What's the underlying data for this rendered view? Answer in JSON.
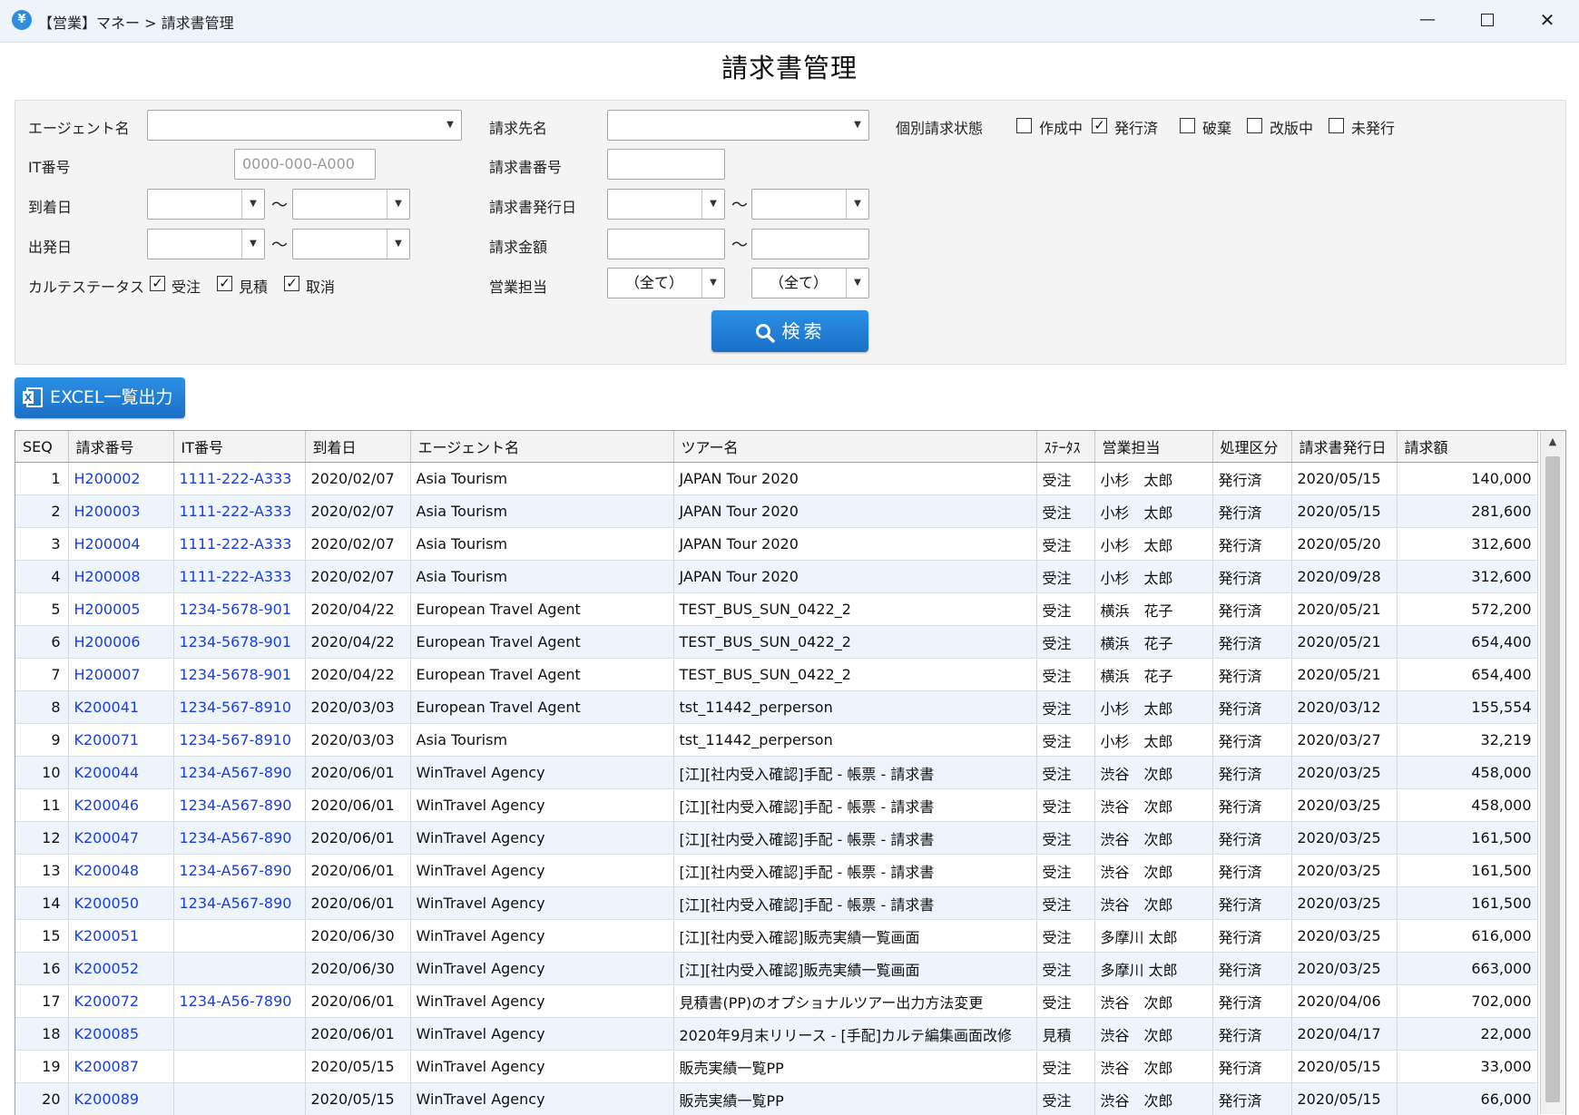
{
  "window": {
    "title": "【営業】マネー > 請求書管理",
    "minimize": "—",
    "close": "✕"
  },
  "page_title": "請求書管理",
  "filters": {
    "agent_name_label": "エージェント名",
    "billing_to_label": "請求先名",
    "individual_status_label": "個別請求状態",
    "status_options": [
      {
        "label": "作成中",
        "checked": false
      },
      {
        "label": "発行済",
        "checked": true
      },
      {
        "label": "破棄",
        "checked": false
      },
      {
        "label": "改版中",
        "checked": false
      },
      {
        "label": "未発行",
        "checked": false
      }
    ],
    "it_number_label": "IT番号",
    "it_number_placeholder": "0000-000-A000",
    "invoice_number_label": "請求書番号",
    "arrival_date_label": "到着日",
    "invoice_issue_date_label": "請求書発行日",
    "departure_date_label": "出発日",
    "invoice_amount_label": "請求金額",
    "tilde": "～",
    "karte_status_label": "カルテステータス",
    "karte_status_options": [
      {
        "label": "受注",
        "checked": true
      },
      {
        "label": "見積",
        "checked": true
      },
      {
        "label": "取消",
        "checked": true
      }
    ],
    "sales_rep_label": "営業担当",
    "sales_rep_value_1": "（全て）",
    "sales_rep_value_2": "（全て）",
    "search_button": "検索"
  },
  "excel_button": "EXCEL一覧出力",
  "table": {
    "columns": [
      "SEQ",
      "請求番号",
      "IT番号",
      "到着日",
      "エージェント名",
      "ツアー名",
      "ｽﾃｰﾀｽ",
      "営業担当",
      "処理区分",
      "請求書発行日",
      "請求額"
    ],
    "rows": [
      [
        "1",
        "H200002",
        "1111-222-A333",
        "2020/02/07",
        "Asia Tourism",
        "JAPAN Tour 2020",
        "受注",
        "小杉　太郎",
        "発行済",
        "2020/05/15",
        "140,000"
      ],
      [
        "2",
        "H200003",
        "1111-222-A333",
        "2020/02/07",
        "Asia Tourism",
        "JAPAN Tour 2020",
        "受注",
        "小杉　太郎",
        "発行済",
        "2020/05/15",
        "281,600"
      ],
      [
        "3",
        "H200004",
        "1111-222-A333",
        "2020/02/07",
        "Asia Tourism",
        "JAPAN Tour 2020",
        "受注",
        "小杉　太郎",
        "発行済",
        "2020/05/20",
        "312,600"
      ],
      [
        "4",
        "H200008",
        "1111-222-A333",
        "2020/02/07",
        "Asia Tourism",
        "JAPAN Tour 2020",
        "受注",
        "小杉　太郎",
        "発行済",
        "2020/09/28",
        "312,600"
      ],
      [
        "5",
        "H200005",
        "1234-5678-901",
        "2020/04/22",
        "European Travel Agent",
        "TEST_BUS_SUN_0422_2",
        "受注",
        "横浜　花子",
        "発行済",
        "2020/05/21",
        "572,200"
      ],
      [
        "6",
        "H200006",
        "1234-5678-901",
        "2020/04/22",
        "European Travel Agent",
        "TEST_BUS_SUN_0422_2",
        "受注",
        "横浜　花子",
        "発行済",
        "2020/05/21",
        "654,400"
      ],
      [
        "7",
        "H200007",
        "1234-5678-901",
        "2020/04/22",
        "European Travel Agent",
        "TEST_BUS_SUN_0422_2",
        "受注",
        "横浜　花子",
        "発行済",
        "2020/05/21",
        "654,400"
      ],
      [
        "8",
        "K200041",
        "1234-567-8910",
        "2020/03/03",
        "European Travel Agent",
        "tst_11442_perperson",
        "受注",
        "小杉　太郎",
        "発行済",
        "2020/03/12",
        "155,554"
      ],
      [
        "9",
        "K200071",
        "1234-567-8910",
        "2020/03/03",
        "Asia Tourism",
        "tst_11442_perperson",
        "受注",
        "小杉　太郎",
        "発行済",
        "2020/03/27",
        "32,219"
      ],
      [
        "10",
        "K200044",
        "1234-A567-890",
        "2020/06/01",
        "WinTravel Agency",
        "[江][社内受入確認]手配 - 帳票 - 請求書",
        "受注",
        "渋谷　次郎",
        "発行済",
        "2020/03/25",
        "458,000"
      ],
      [
        "11",
        "K200046",
        "1234-A567-890",
        "2020/06/01",
        "WinTravel Agency",
        "[江][社内受入確認]手配 - 帳票 - 請求書",
        "受注",
        "渋谷　次郎",
        "発行済",
        "2020/03/25",
        "458,000"
      ],
      [
        "12",
        "K200047",
        "1234-A567-890",
        "2020/06/01",
        "WinTravel Agency",
        "[江][社内受入確認]手配 - 帳票 - 請求書",
        "受注",
        "渋谷　次郎",
        "発行済",
        "2020/03/25",
        "161,500"
      ],
      [
        "13",
        "K200048",
        "1234-A567-890",
        "2020/06/01",
        "WinTravel Agency",
        "[江][社内受入確認]手配 - 帳票 - 請求書",
        "受注",
        "渋谷　次郎",
        "発行済",
        "2020/03/25",
        "161,500"
      ],
      [
        "14",
        "K200050",
        "1234-A567-890",
        "2020/06/01",
        "WinTravel Agency",
        "[江][社内受入確認]手配 - 帳票 - 請求書",
        "受注",
        "渋谷　次郎",
        "発行済",
        "2020/03/25",
        "161,500"
      ],
      [
        "15",
        "K200051",
        "",
        "2020/06/30",
        "WinTravel Agency",
        "[江][社内受入確認]販売実績一覧画面",
        "受注",
        "多摩川 太郎",
        "発行済",
        "2020/03/25",
        "616,000"
      ],
      [
        "16",
        "K200052",
        "",
        "2020/06/30",
        "WinTravel Agency",
        "[江][社内受入確認]販売実績一覧画面",
        "受注",
        "多摩川 太郎",
        "発行済",
        "2020/03/25",
        "663,000"
      ],
      [
        "17",
        "K200072",
        "1234-A56-7890",
        "2020/06/01",
        "WinTravel Agency",
        "見積書(PP)のオプショナルツアー出力方法変更",
        "受注",
        "渋谷　次郎",
        "発行済",
        "2020/04/06",
        "702,000"
      ],
      [
        "18",
        "K200085",
        "",
        "2020/06/01",
        "WinTravel Agency",
        "2020年9月末リリース - [手配]カルテ編集画面改修",
        "見積",
        "渋谷　次郎",
        "発行済",
        "2020/04/17",
        "22,000"
      ],
      [
        "19",
        "K200087",
        "",
        "2020/05/15",
        "WinTravel Agency",
        "販売実績一覧PP",
        "受注",
        "渋谷　次郎",
        "発行済",
        "2020/05/15",
        "33,000"
      ],
      [
        "20",
        "K200089",
        "",
        "2020/05/15",
        "WinTravel Agency",
        "販売実績一覧PP",
        "受注",
        "渋谷　次郎",
        "発行済",
        "2020/05/15",
        "66,000"
      ]
    ]
  }
}
